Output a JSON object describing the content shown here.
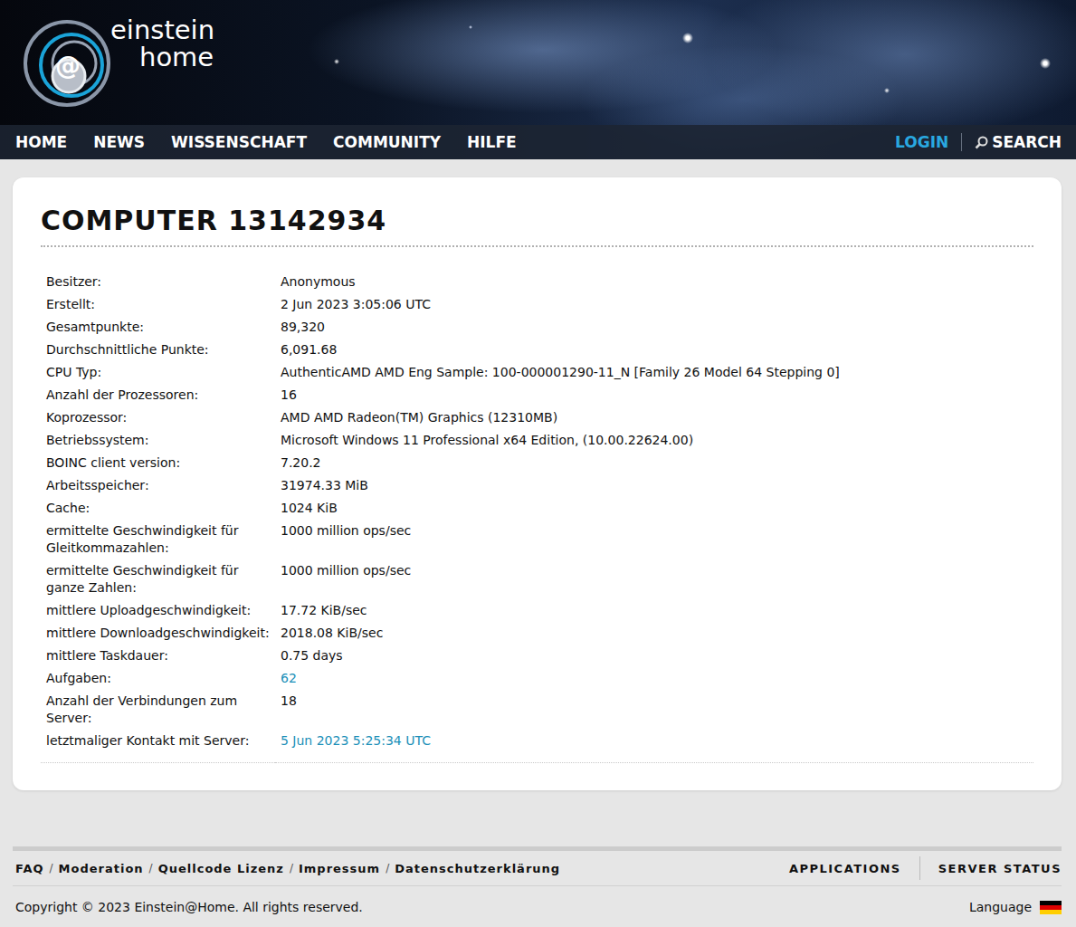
{
  "header": {
    "logo": {
      "top": "einstein",
      "at": "@",
      "bottom": "home"
    },
    "nav": [
      "HOME",
      "NEWS",
      "WISSENSCHAFT",
      "COMMUNITY",
      "HILFE"
    ],
    "login": "LOGIN",
    "search": "SEARCH"
  },
  "card": {
    "title": "COMPUTER 13142934",
    "rows": [
      {
        "label": "Besitzer:",
        "value": "Anonymous",
        "link": false
      },
      {
        "label": "Erstellt:",
        "value": "2 Jun 2023 3:05:06 UTC",
        "link": false
      },
      {
        "label": "Gesamtpunkte:",
        "value": "89,320",
        "link": false
      },
      {
        "label": "Durchschnittliche Punkte:",
        "value": "6,091.68",
        "link": false
      },
      {
        "label": "CPU Typ:",
        "value": "AuthenticAMD AMD Eng Sample: 100-000001290-11_N [Family 26 Model 64 Stepping 0]",
        "link": false
      },
      {
        "label": "Anzahl der Prozessoren:",
        "value": "16",
        "link": false
      },
      {
        "label": "Koprozessor:",
        "value": "AMD AMD Radeon(TM) Graphics (12310MB)",
        "link": false
      },
      {
        "label": "Betriebssystem:",
        "value": "Microsoft Windows 11 Professional x64 Edition, (10.00.22624.00)",
        "link": false
      },
      {
        "label": "BOINC client version:",
        "value": "7.20.2",
        "link": false
      },
      {
        "label": "Arbeitsspeicher:",
        "value": "31974.33 MiB",
        "link": false
      },
      {
        "label": "Cache:",
        "value": "1024 KiB",
        "link": false
      },
      {
        "label": "ermittelte Geschwindigkeit für Gleitkommazahlen:",
        "value": "1000 million ops/sec",
        "link": false
      },
      {
        "label": "ermittelte Geschwindigkeit für ganze Zahlen:",
        "value": "1000 million ops/sec",
        "link": false
      },
      {
        "label": "mittlere Uploadgeschwindigkeit:",
        "value": "17.72 KiB/sec",
        "link": false
      },
      {
        "label": "mittlere Downloadgeschwindigkeit:",
        "value": "2018.08 KiB/sec",
        "link": false
      },
      {
        "label": "mittlere Taskdauer:",
        "value": "0.75 days",
        "link": false
      },
      {
        "label": "Aufgaben:",
        "value": "62",
        "link": true
      },
      {
        "label": "Anzahl der Verbindungen zum Server:",
        "value": "18",
        "link": false
      },
      {
        "label": "letztmaliger Kontakt mit Server:",
        "value": "5 Jun 2023 5:25:34 UTC",
        "link": true
      }
    ]
  },
  "footer": {
    "links": [
      "FAQ",
      "Moderation",
      "Quellcode Lizenz",
      "Impressum",
      "Datenschutzerklärung"
    ],
    "separator": "/",
    "right": [
      "APPLICATIONS",
      "SERVER STATUS"
    ],
    "copyright": "Copyright © 2023 Einstein@Home. All rights reserved.",
    "language": "Language"
  }
}
